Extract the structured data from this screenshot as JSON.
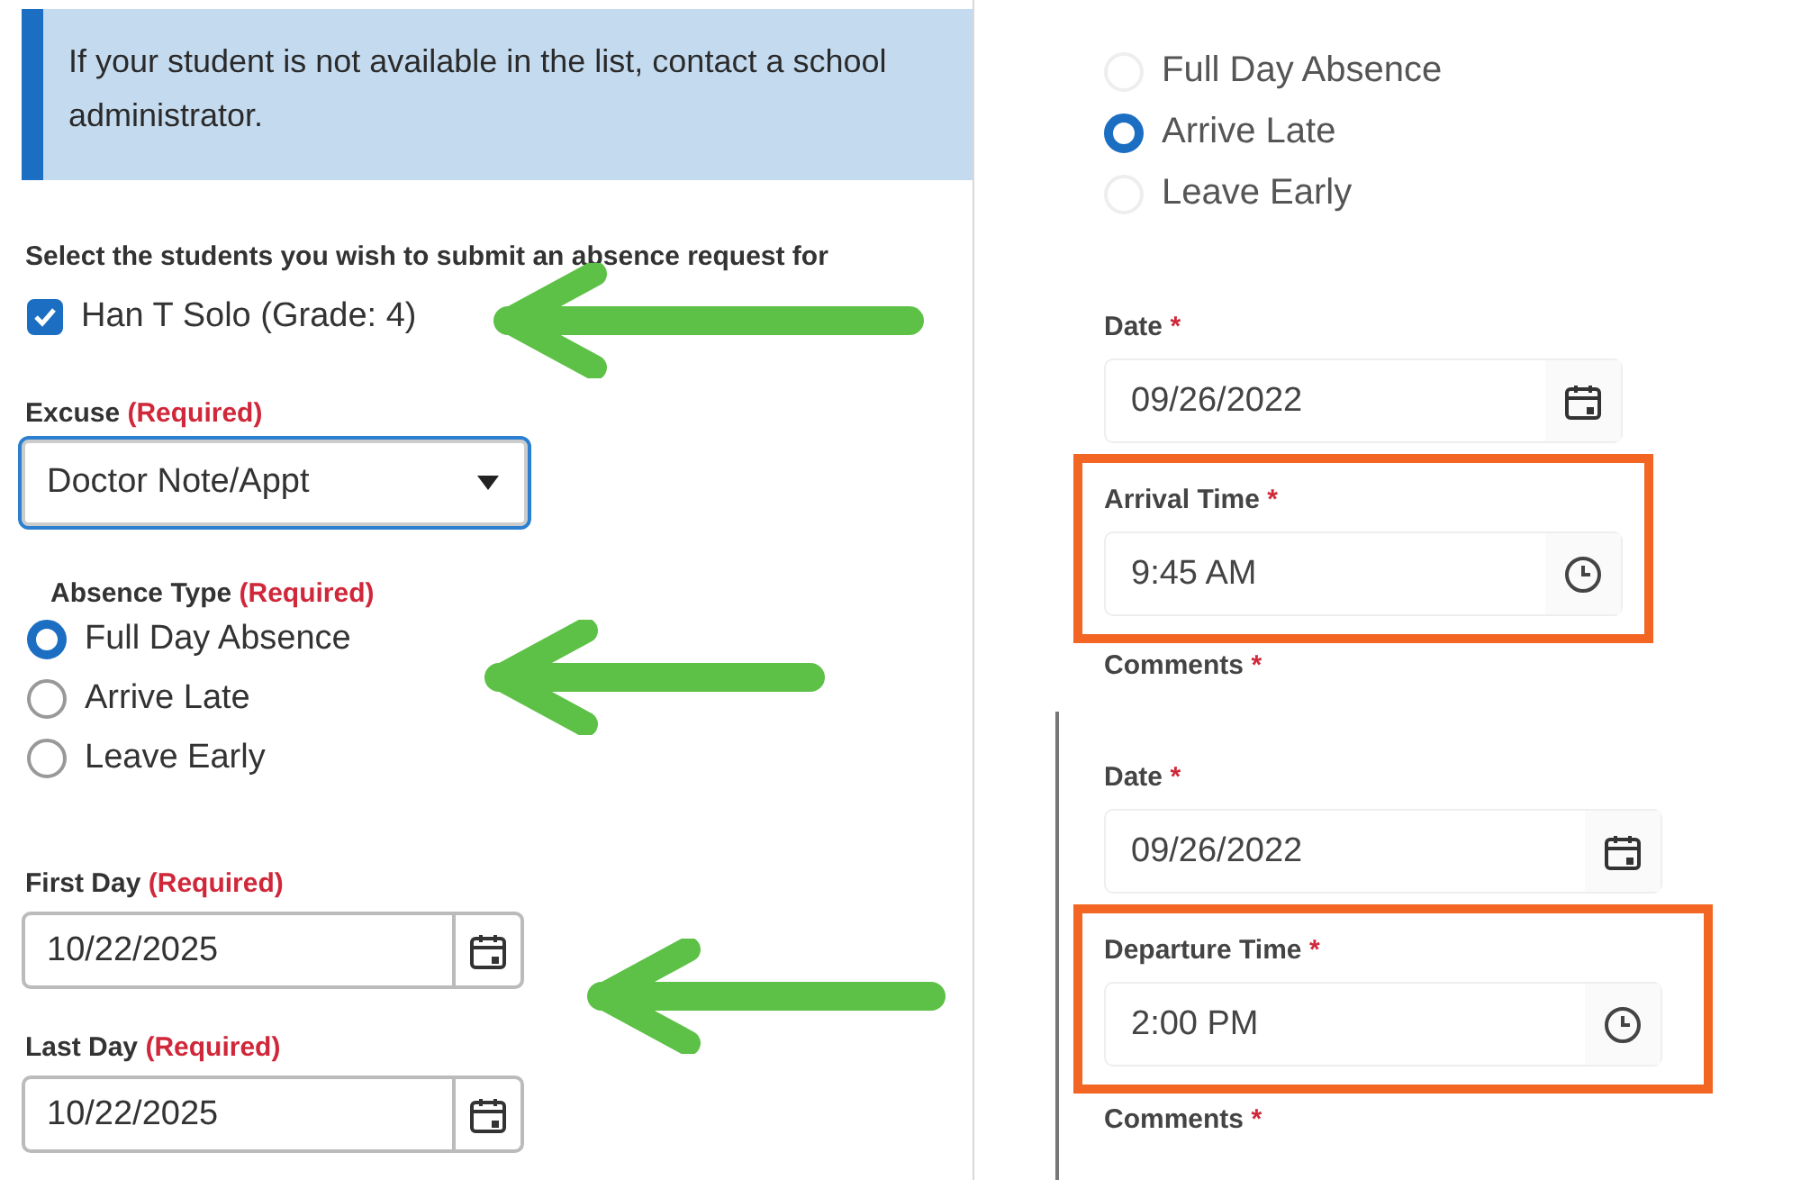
{
  "left_panel": {
    "notice": "If your student is not available in the list, contact a school administrator.",
    "students_label": "Select the students you wish to submit an absence request for",
    "students": [
      {
        "name": "Han T Solo (Grade: 4)",
        "checked": true
      }
    ],
    "excuse": {
      "label": "Excuse",
      "required": "(Required)",
      "value": "Doctor Note/Appt"
    },
    "absence_type": {
      "label": "Absence Type",
      "required": "(Required)",
      "options": [
        {
          "label": "Full Day Absence",
          "selected": true
        },
        {
          "label": "Arrive Late",
          "selected": false
        },
        {
          "label": "Leave Early",
          "selected": false
        }
      ]
    },
    "dates": [
      {
        "label": "First Day",
        "required": "(Required)",
        "value": "10/22/2025"
      },
      {
        "label": "Last Day",
        "required": "(Required)",
        "value": "10/22/2025"
      }
    ]
  },
  "arrive_late_panel": {
    "absence_type": {
      "options": [
        {
          "label": "Full Day Absence",
          "selected": false
        },
        {
          "label": "Arrive Late",
          "selected": true
        },
        {
          "label": "Leave Early",
          "selected": false
        }
      ]
    },
    "date": {
      "label": "Date",
      "required": "*",
      "value": "09/26/2022"
    },
    "time": {
      "label": "Arrival Time",
      "required": "*",
      "value": "9:45 AM",
      "highlighted": true
    },
    "comments": {
      "label": "Comments",
      "required": "*"
    }
  },
  "leave_early_panel": {
    "date": {
      "label": "Date",
      "required": "*",
      "value": "09/26/2022"
    },
    "time": {
      "label": "Departure Time",
      "required": "*",
      "value": "2:00 PM",
      "highlighted": true
    },
    "comments": {
      "label": "Comments",
      "required": "*"
    }
  }
}
